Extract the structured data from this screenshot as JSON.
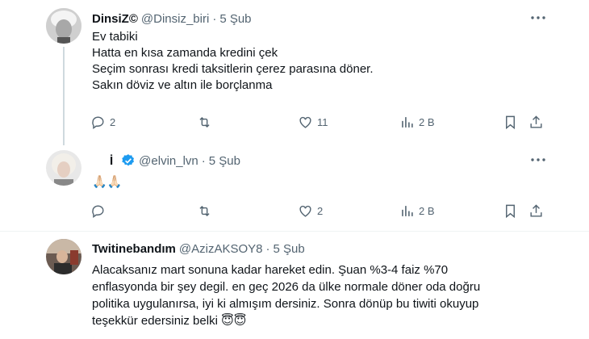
{
  "tweets": [
    {
      "name": "DinsiZ©",
      "handle": "@Dinsiz_biri",
      "sep": "·",
      "time": "5 Şub",
      "lines": [
        "Ev tabiki",
        "Hatta en kısa zamanda kredini çek",
        "Seçim sonrası kredi taksitlerin çerez parasına döner.",
        "Sakın döviz ve altın ile borçlanma"
      ],
      "reply_count": "2",
      "retweet_count": "",
      "like_count": "11",
      "views_count": "2 B"
    },
    {
      "name": "İ",
      "handle": "@elvin_lvn",
      "sep": "·",
      "time": "5 Şub",
      "emoji_text": "🙏🏻🙏🏻",
      "reply_count": "",
      "retweet_count": "",
      "like_count": "2",
      "views_count": "2 B",
      "verified_color": "#1d9bf0"
    },
    {
      "name": "Twitinebandım",
      "handle": "@AzizAKSOY8",
      "sep": "·",
      "time": "5 Şub",
      "lines": [
        "Alacaksanız mart sonuna kadar hareket edin. Şuan %3-4 faiz %70",
        "enflasyonda bir şey degil. en geç 2026 da ülke normale döner oda doğru",
        "politika uygulanırsa, iyi ki almışım dersiniz. Sonra dönüp bu tiwiti okuyup",
        "teşekkür edersiniz belki 😇😇"
      ]
    }
  ],
  "icons": [
    "more-icon",
    "reply-icon",
    "retweet-icon",
    "like-icon",
    "views-icon",
    "bookmark-icon",
    "share-icon",
    "verified-icon"
  ],
  "colors": {
    "text": "#0f1419",
    "secondary": "#536471",
    "verified": "#1d9bf0",
    "divider": "#eff3f4"
  }
}
